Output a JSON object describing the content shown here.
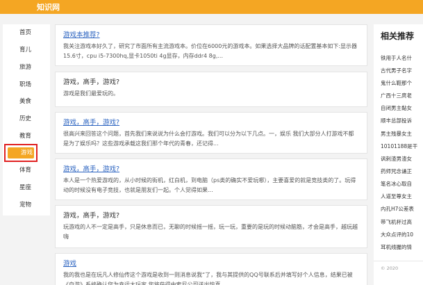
{
  "header": {
    "logo_text": "知识网"
  },
  "sidebar": {
    "items": [
      {
        "label": "首页"
      },
      {
        "label": "育儿"
      },
      {
        "label": "旅游"
      },
      {
        "label": "职场"
      },
      {
        "label": "美食"
      },
      {
        "label": "历史"
      },
      {
        "label": "教育"
      },
      {
        "label": "游戏",
        "active": true
      },
      {
        "label": "体育"
      },
      {
        "label": "星座"
      },
      {
        "label": "宠物"
      }
    ]
  },
  "feed": {
    "cards": [
      {
        "title": "游戏本推荐?",
        "is_link": true,
        "desc": "我关注游戏本好久了，研究了市面所有主流游戏本。价位在6000元的游戏本。如果选择大品牌的话配置基本如下:显示器15.6寸，cpu i5-7300hq,显卡1050ti 4g显存，内存ddr4 8g,..."
      },
      {
        "title": "游戏，高手，游戏?",
        "is_link": false,
        "desc": "游戏是我们最爱玩的。"
      },
      {
        "title": "游戏，高手，游戏?",
        "is_link": true,
        "desc": "很高兴来回答这个问题，首先我们来说说为什么会打游戏。我们可以分为以下几点。一，娱乐 我们大部分人打游戏不都是为了娱乐吗？这些游戏承载这我们那个年代的青春，还记得..."
      },
      {
        "title": "游戏，高手，游戏?",
        "is_link": true,
        "desc": "本人是一个热爱游戏的，从小时候的街机，红白机，到电脑（ps类的确实不爱玩哪），主要喜爱的就是竞技类的了。玩得动的时候没有电子竞技，也就是朋友们一起。个人觉得如果..."
      },
      {
        "title": "游戏，高手，游戏?",
        "is_link": false,
        "desc": "玩游戏的人不一定是高手，只是休息而已，无聊的时候摇一摇，玩一玩，重要的是玩的时候动脑筋，才会是高手，越玩越嗨"
      },
      {
        "title": "游戏",
        "is_link": true,
        "desc": "我的我也是在玩凡人修仙传这个游戏是收到一则消息说我“了，我与其提供的QQ号联系后并填写好个人信息，结果已被《自游》系统确认您为幸运大玩家 您将获得由索尼公司送出惊喜..."
      }
    ]
  },
  "related": {
    "title": "相关推荐",
    "items": [
      "铁用于人名什",
      "古代男子名字",
      "鬼什么鞋那个",
      "广西十三庹老",
      "自闭男主黏女",
      "顺丰总部投诉",
      "男主残暴女主",
      "10101188是干",
      "讽刺渣男渣女",
      "药师咒念诵正",
      "笔名冰心取自",
      "人道至尊女主",
      "内孔H7公差表",
      "带飞机杯过高",
      "大众点评的10",
      "耳机线握的情"
    ],
    "copyright": "© 2020"
  }
}
